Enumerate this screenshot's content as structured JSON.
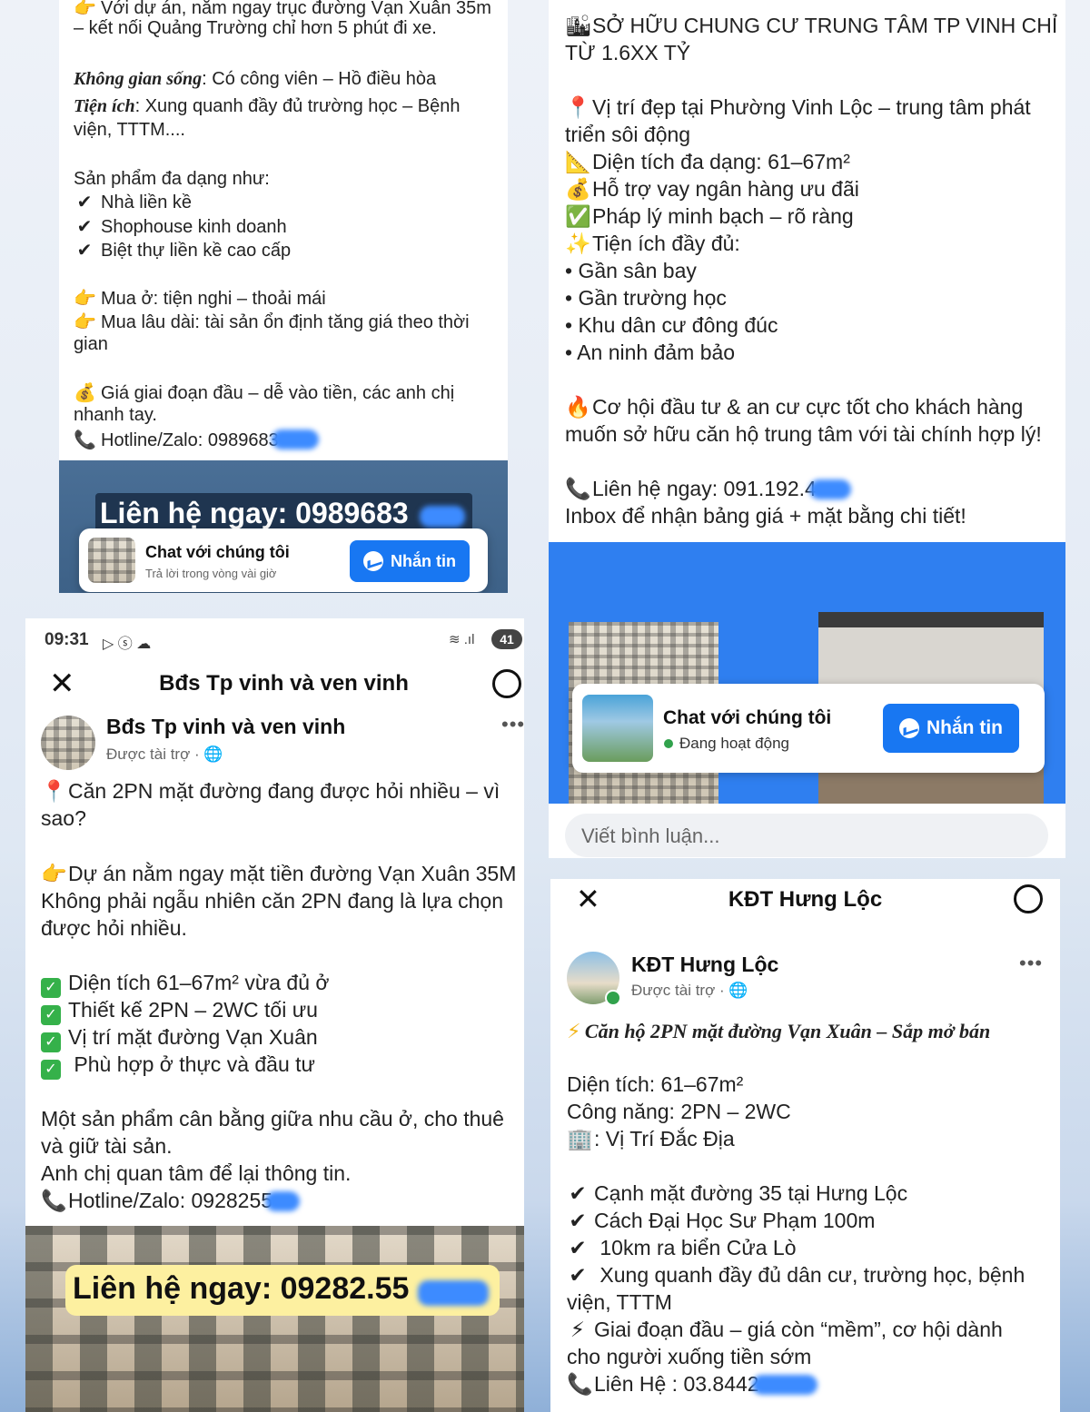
{
  "top_left": {
    "lines": [
      {
        "icon": "👉",
        "text": "Với dự án, nằm ngay trục đường Vạn Xuân 35m"
      },
      {
        "text": "– kết nối Quảng Trường chỉ hơn 5 phút đi xe."
      },
      {
        "label": "Không gian sống",
        "text": ": Có công viên – Hồ điều hòa"
      },
      {
        "label": "Tiện ích",
        "text": ": Xung quanh đầy đủ trường học – Bệnh"
      },
      {
        "text": "viện, TTTM...."
      },
      {
        "text": "Sản phẩm đa dạng như:"
      },
      {
        "icon": "✔",
        "text": "Nhà liền kề"
      },
      {
        "icon": "✔",
        "text": "Shophouse kinh doanh"
      },
      {
        "icon": "✔",
        "text": "Biệt thự liền kề cao cấp"
      },
      {
        "icon": "👉",
        "text": "Mua ở: tiện nghi – thoải mái"
      },
      {
        "icon": "👉",
        "text": "Mua lâu dài: tài sản ổn định tăng giá theo thời"
      },
      {
        "text": "gian"
      },
      {
        "icon": "💰",
        "text": "Giá giai đoạn đầu – dễ vào tiền, các anh chị"
      },
      {
        "text": "nhanh tay."
      },
      {
        "icon": "📞",
        "text": "Hotline/Zalo: 0989683"
      }
    ],
    "banner_text": "Liên hệ ngay: 0989683",
    "chat_title": "Chat với chúng tôi",
    "chat_sub": "Trả lời trong vòng vài giờ",
    "button": "Nhắn tin"
  },
  "top_right": {
    "lines": [
      {
        "icon": "🏙",
        "text": "SỞ HỮU CHUNG CƯ TRUNG TÂM TP VINH CHỈ"
      },
      {
        "text": "TỪ 1.6XX TỶ"
      },
      {
        "icon": "📍",
        "text": "Vị trí đẹp tại Phường Vinh Lộc – trung tâm phát"
      },
      {
        "text": "triển sôi động"
      },
      {
        "icon": "📐",
        "text": "Diện tích đa dạng: 61–67m²"
      },
      {
        "icon": "💰",
        "text": "Hỗ trợ vay ngân hàng ưu đãi"
      },
      {
        "icon": "✅",
        "text": "Pháp lý minh bạch – rõ ràng"
      },
      {
        "icon": "✨",
        "text": "Tiện ích đầy đủ:"
      },
      {
        "text": "• Gần sân bay"
      },
      {
        "text": "• Gần trường học"
      },
      {
        "text": "• Khu dân cư đông đúc"
      },
      {
        "text": "• An ninh đảm bảo"
      },
      {
        "icon": "🔥",
        "text": "Cơ hội đầu tư & an cư cực tốt cho khách hàng"
      },
      {
        "text": "muốn sở hữu căn hộ trung tâm với tài chính hợp lý!"
      },
      {
        "icon": "📞",
        "text": "Liên hệ ngay: 091.192.4"
      },
      {
        "text": "Inbox để nhận bảng giá + mặt bằng chi tiết!"
      }
    ],
    "chat_title": "Chat với chúng tôi",
    "chat_status": "Đang hoạt động",
    "button": "Nhắn tin",
    "comment_placeholder": "Viết bình luận..."
  },
  "bottom_left": {
    "status": {
      "time": "09:31",
      "battery": "41"
    },
    "header_title": "Bđs Tp vinh và ven vinh",
    "page_name": "Bđs Tp vinh và ven vinh",
    "sponsored": "Được tài trợ · ",
    "lines": [
      {
        "icon": "📍",
        "text": "Căn 2PN mặt đường đang được hỏi nhiều – vì"
      },
      {
        "text": "sao?"
      },
      {
        "icon": "👉",
        "text": "Dự án nằm ngay mặt tiền đường Vạn Xuân 35M"
      },
      {
        "text": "Không phải ngẫu nhiên căn 2PN đang là lựa chọn"
      },
      {
        "text": "được hỏi nhiều."
      },
      {
        "check": true,
        "text": "Diện tích 61–67m² vừa đủ ở"
      },
      {
        "check": true,
        "text": "Thiết kế 2PN – 2WC tối ưu"
      },
      {
        "check": true,
        "text": "Vị trí mặt đường Vạn Xuân"
      },
      {
        "check": true,
        "text": " Phù hợp ở thực và đầu tư"
      },
      {
        "text": "Một sản phẩm cân bằng giữa nhu cầu ở, cho thuê"
      },
      {
        "text": "và giữ tài sản."
      },
      {
        "text": "Anh chị quan tâm để lại thông tin."
      },
      {
        "icon": "📞",
        "text": "Hotline/Zalo: 0928255"
      }
    ],
    "banner_text": "Liên hệ ngay: 09282.55"
  },
  "bottom_right": {
    "header_title": "KĐT Hưng Lộc",
    "page_name": "KĐT Hưng Lộc",
    "sponsored": "Được tài trợ · ",
    "headline": "Căn hộ 2PN mặt đường Vạn Xuân – Sắp mở bán",
    "lines": [
      {
        "text": "Diện tích: 61–67m²"
      },
      {
        "text": "Công năng:  2PN – 2WC"
      },
      {
        "icon": "🏢",
        "text": ": Vị Trí Đắc Địa"
      },
      {
        "icon": "✔",
        "text": "Cạnh mặt đường 35 tại Hưng Lộc"
      },
      {
        "icon": "✔",
        "text": "Cách Đại Học Sư Phạm 100m"
      },
      {
        "icon": "✔",
        "text": " 10km ra biển Cửa Lò"
      },
      {
        "icon": "✔",
        "text": " Xung quanh đầy đủ dân cư, trường học, bệnh"
      },
      {
        "text": "viện, TTTM"
      },
      {
        "icon": "⚡",
        "text": "Giai đoạn đầu – giá còn “mềm”, cơ hội dành"
      },
      {
        "text": "cho người xuống tiền sớm"
      },
      {
        "icon": "📞",
        "text": "Liên Hệ : 03.8442"
      }
    ]
  }
}
